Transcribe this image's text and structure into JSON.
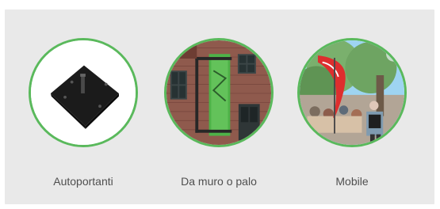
{
  "panel": {
    "accent_color": "#5ab95c",
    "background_color": "#e9e9e9"
  },
  "items": [
    {
      "label": "Autoportanti",
      "image_name": "black-base-plate-image"
    },
    {
      "label": "Da muro o palo",
      "image_name": "wall-banner-image"
    },
    {
      "label": "Mobile",
      "image_name": "feather-flag-image"
    }
  ]
}
